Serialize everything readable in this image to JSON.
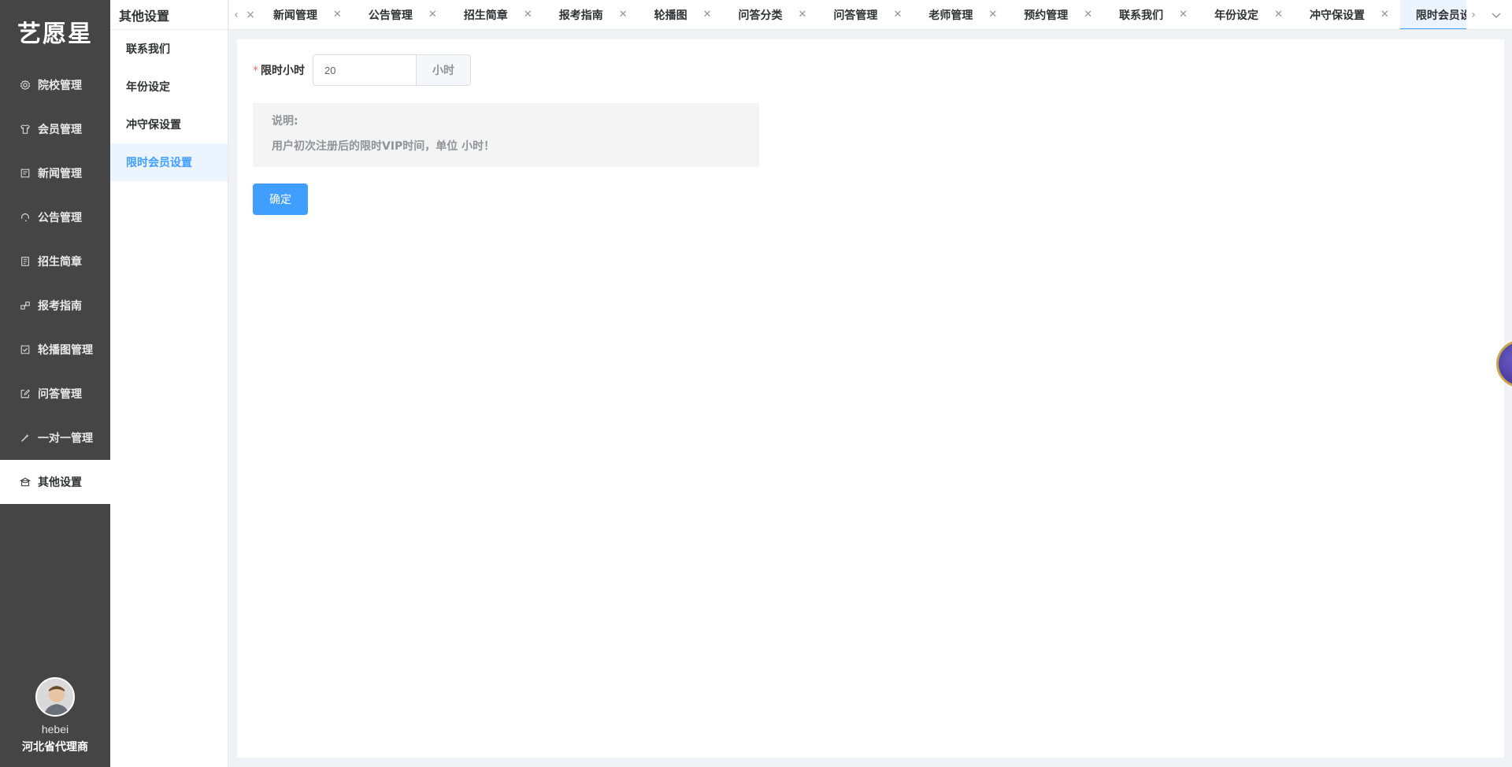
{
  "app": {
    "logo": "艺愿星"
  },
  "sidebar": {
    "items": [
      {
        "label": "院校管理",
        "icon": "gear-icon"
      },
      {
        "label": "会员管理",
        "icon": "shirt-icon"
      },
      {
        "label": "新闻管理",
        "icon": "news-icon"
      },
      {
        "label": "公告管理",
        "icon": "headset-icon"
      },
      {
        "label": "招生简章",
        "icon": "document-icon"
      },
      {
        "label": "报考指南",
        "icon": "share-icon"
      },
      {
        "label": "轮播图管理",
        "icon": "checkbox-icon"
      },
      {
        "label": "问答管理",
        "icon": "edit-icon"
      },
      {
        "label": "一对一管理",
        "icon": "magic-wand-icon"
      },
      {
        "label": "其他设置",
        "icon": "bank-icon",
        "active": true
      }
    ]
  },
  "user": {
    "name": "hebei",
    "role": "河北省代理商"
  },
  "subsidebar": {
    "title": "其他设置",
    "items": [
      {
        "label": "联系我们"
      },
      {
        "label": "年份设定"
      },
      {
        "label": "冲守保设置"
      },
      {
        "label": "限时会员设置",
        "active": true
      }
    ]
  },
  "tabs": [
    {
      "label": "新闻管理"
    },
    {
      "label": "公告管理"
    },
    {
      "label": "招生简章"
    },
    {
      "label": "报考指南"
    },
    {
      "label": "轮播图"
    },
    {
      "label": "问答分类"
    },
    {
      "label": "问答管理"
    },
    {
      "label": "老师管理"
    },
    {
      "label": "预约管理"
    },
    {
      "label": "联系我们"
    },
    {
      "label": "年份设定"
    },
    {
      "label": "冲守保设置"
    },
    {
      "label": "限时会员设置",
      "active": true
    }
  ],
  "form": {
    "label": "限时小时",
    "required_mark": "*",
    "value": "20",
    "unit": "小时",
    "note_title": "说明:",
    "note_text": "用户初次注册后的限时VIP时间，单位 小时！",
    "submit_label": "确定"
  },
  "colors": {
    "primary": "#409eff",
    "sidebar_bg": "#454545",
    "active_sub_bg": "#ecf5ff"
  }
}
